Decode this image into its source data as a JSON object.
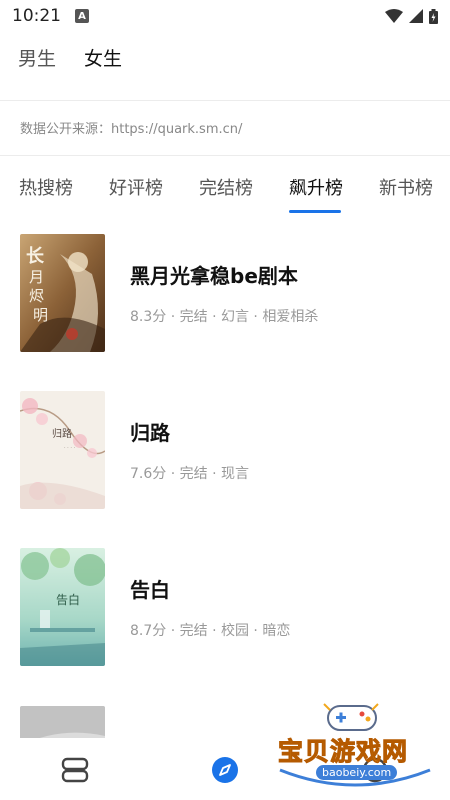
{
  "status": {
    "time": "10:21",
    "badge": "A"
  },
  "gender_tabs": [
    {
      "label": "男生",
      "active": false
    },
    {
      "label": "女生",
      "active": true
    }
  ],
  "source_text": "数据公开来源：https://quark.sm.cn/",
  "rank_tabs": [
    {
      "label": "热搜榜",
      "active": false
    },
    {
      "label": "好评榜",
      "active": false
    },
    {
      "label": "完结榜",
      "active": false
    },
    {
      "label": "飙升榜",
      "active": true
    },
    {
      "label": "新书榜",
      "active": false
    }
  ],
  "books": [
    {
      "title": "黑月光拿稳be剧本",
      "meta": "8.3分 · 完结 · 幻言 · 相爱相杀",
      "cover_text": "长月烬明"
    },
    {
      "title": "归路",
      "meta": "7.6分 · 完结 · 现言",
      "cover_text": "归路"
    },
    {
      "title": "告白",
      "meta": "8.7分 · 完结 · 校园 · 暗恋",
      "cover_text": "告白"
    },
    {
      "title": "",
      "meta": "",
      "cover_text": ""
    }
  ],
  "watermark": {
    "text": "宝贝游戏网",
    "url": "baobeiy.com"
  },
  "colors": {
    "accent": "#1a73e8",
    "nav_active": "#1a73e8",
    "watermark": "#f2a81d"
  }
}
